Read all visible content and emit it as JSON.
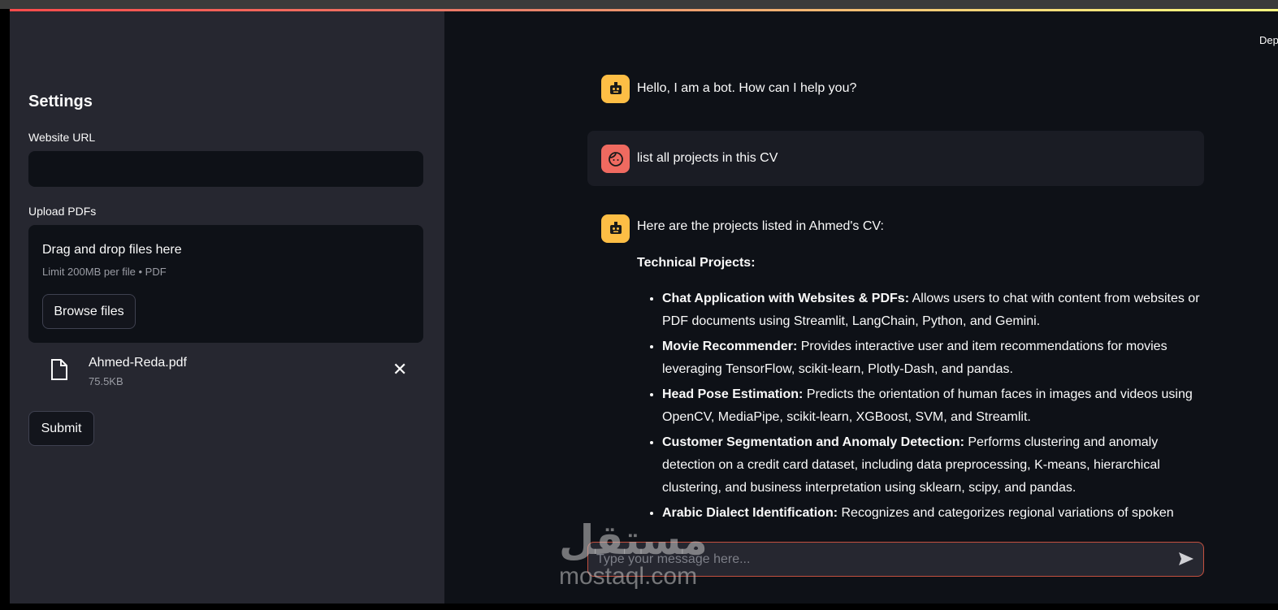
{
  "sidebar": {
    "title": "Settings",
    "url_label": "Website URL",
    "url_value": "",
    "upload_label": "Upload PDFs",
    "drop_title": "Drag and drop files here",
    "drop_hint": "Limit 200MB per file • PDF",
    "browse": "Browse files",
    "file_name": "Ahmed-Reda.pdf",
    "file_size": "75.5KB",
    "submit": "Submit"
  },
  "header": {
    "deploy": "Deploy"
  },
  "chat": {
    "m1": "Hello, I am a bot. How can I help you?",
    "m2": "list all projects in this CV",
    "m3": "Here are the projects listed in Ahmed's CV:",
    "section": "Technical Projects:",
    "projects": [
      {
        "title": "Chat Application with Websites & PDFs:",
        "desc": " Allows users to chat with content from websites or PDF documents using Streamlit, LangChain, Python, and Gemini."
      },
      {
        "title": "Movie Recommender:",
        "desc": " Provides interactive user and item recommendations for movies leveraging TensorFlow, scikit-learn, Plotly-Dash, and pandas."
      },
      {
        "title": "Head Pose Estimation:",
        "desc": " Predicts the orientation of human faces in images and videos using OpenCV, MediaPipe, scikit-learn, XGBoost, SVM, and Streamlit."
      },
      {
        "title": "Customer Segmentation and Anomaly Detection:",
        "desc": " Performs clustering and anomaly detection on a credit card dataset, including data preprocessing, K-means, hierarchical clustering, and business interpretation using sklearn, scipy, and pandas."
      },
      {
        "title": "Arabic Dialect Identification:",
        "desc": " Recognizes and categorizes regional variations of spoken"
      }
    ],
    "placeholder": "Type your message here..."
  },
  "watermark": {
    "arabic": "مستقل",
    "latin": "mostaql.com"
  },
  "colors": {
    "bot": "#fdbe45",
    "user": "#ef6a60",
    "sidebar": "#262730",
    "main": "#0e1117"
  }
}
